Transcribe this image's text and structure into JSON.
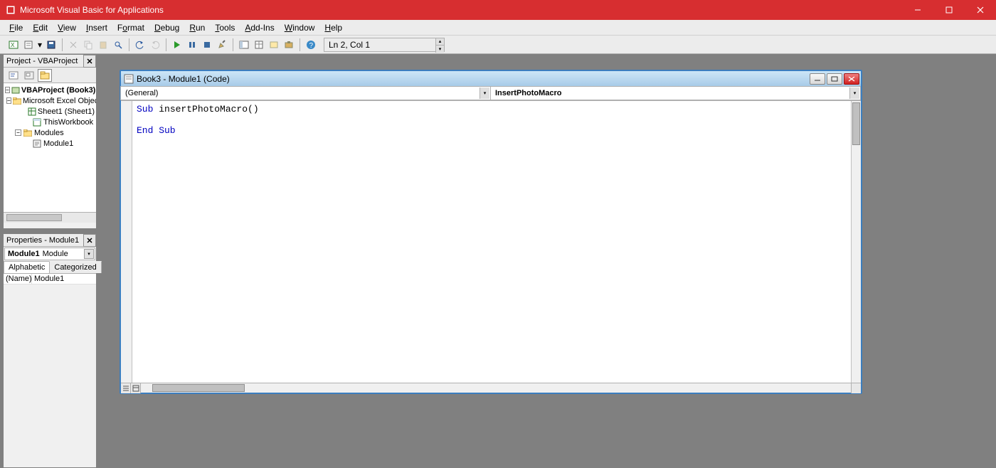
{
  "app_title": "Microsoft Visual Basic for Applications",
  "menu": [
    "File",
    "Edit",
    "View",
    "Insert",
    "Format",
    "Debug",
    "Run",
    "Tools",
    "Add-Ins",
    "Window",
    "Help"
  ],
  "menu_mn": [
    "F",
    "E",
    "V",
    "I",
    "o",
    "D",
    "R",
    "T",
    "A",
    "W",
    "H"
  ],
  "toolbar_status": "Ln 2, Col 1",
  "project_panel": {
    "title": "Project - VBAProject",
    "root": "VBAProject (Book3)",
    "excel_objects_label": "Microsoft Excel Objects",
    "sheet1_label": "Sheet1 (Sheet1)",
    "thisworkbook_label": "ThisWorkbook",
    "modules_label": "Modules",
    "module1_label": "Module1"
  },
  "properties_panel": {
    "title": "Properties - Module1",
    "obj_name": "Module1",
    "obj_type": "Module",
    "tabs": [
      "Alphabetic",
      "Categorized"
    ],
    "rows": [
      {
        "k": "(Name)",
        "v": "Module1"
      }
    ]
  },
  "code_window": {
    "title": "Book3 - Module1 (Code)",
    "left_combo": "(General)",
    "right_combo": "InsertPhotoMacro",
    "code_lines": [
      {
        "t": "kw",
        "s": "Sub "
      },
      {
        "t": "",
        "s": "insertPhotoMacro()"
      },
      {
        "t": "nl"
      },
      {
        "t": "nl"
      },
      {
        "t": "kw",
        "s": "End Sub"
      }
    ]
  }
}
